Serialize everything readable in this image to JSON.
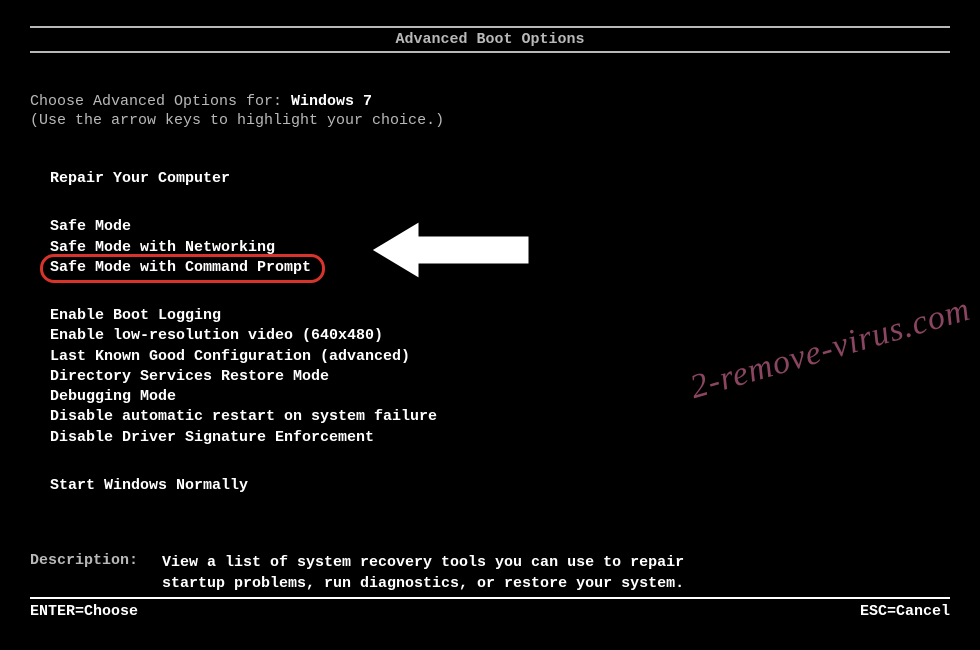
{
  "title": "Advanced Boot Options",
  "choose_prefix": "Choose Advanced Options for: ",
  "os_name": "Windows 7",
  "hint": "(Use the arrow keys to highlight your choice.)",
  "groups": [
    {
      "items": [
        "Repair Your Computer"
      ]
    },
    {
      "items": [
        "Safe Mode",
        "Safe Mode with Networking",
        "Safe Mode with Command Prompt"
      ]
    },
    {
      "items": [
        "Enable Boot Logging",
        "Enable low-resolution video (640x480)",
        "Last Known Good Configuration (advanced)",
        "Directory Services Restore Mode",
        "Debugging Mode",
        "Disable automatic restart on system failure",
        "Disable Driver Signature Enforcement"
      ]
    },
    {
      "items": [
        "Start Windows Normally"
      ]
    }
  ],
  "highlighted_item": "Safe Mode with Command Prompt",
  "description": {
    "label": "Description:",
    "text": "View a list of system recovery tools you can use to repair startup problems, run diagnostics, or restore your system."
  },
  "footer": {
    "left": "ENTER=Choose",
    "right": "ESC=Cancel"
  },
  "watermark": "2-remove-virus.com"
}
